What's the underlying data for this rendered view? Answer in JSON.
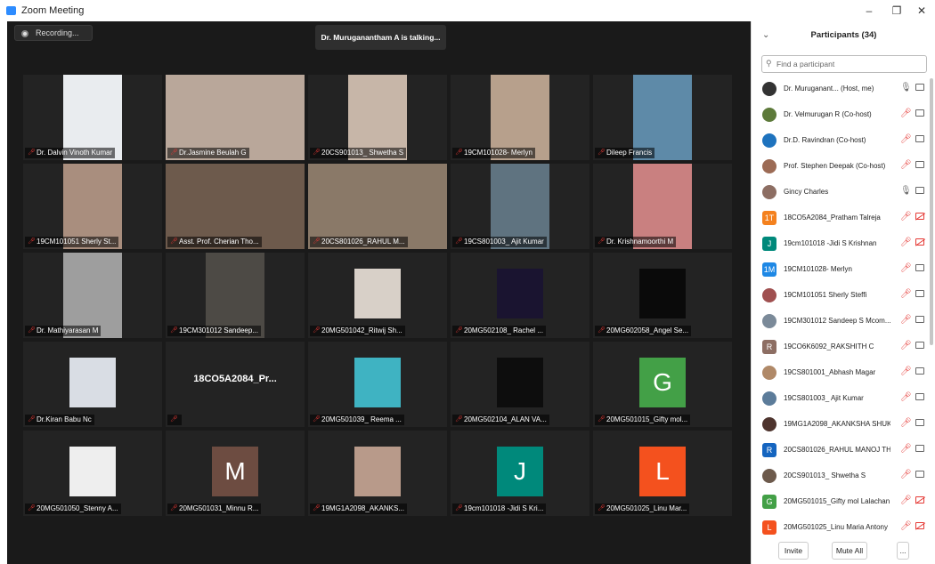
{
  "window": {
    "title": "Zoom Meeting"
  },
  "meeting": {
    "recording_label": "Recording...",
    "talking_label": "Dr. Muruganantham A is talking..."
  },
  "tiles": [
    {
      "name": "Dr. Dalvin Vinoth Kumar",
      "color": "#e9ecef"
    },
    {
      "name": "Dr.Jasmine Beulah G",
      "color": "#b9a79a"
    },
    {
      "name": "20CS901013_ Shwetha S",
      "color": "#c7b6a8"
    },
    {
      "name": "19CM101028- Merlyn",
      "color": "#b7a08c"
    },
    {
      "name": "Dileep Francis",
      "color": "#5e8aa8"
    },
    {
      "name": "19CM101051 Sherly St...",
      "color": "#a98e7e"
    },
    {
      "name": "Asst. Prof. Cherian Tho...",
      "color": "#6d5a4c"
    },
    {
      "name": "20CS801026_RAHUL M...",
      "color": "#8a7968"
    },
    {
      "name": "19CS801003_ Ajit Kumar",
      "color": "#5f7380"
    },
    {
      "name": "Dr. Krishnamoorthi M",
      "color": "#c98080"
    },
    {
      "name": "Dr. Mathiyarasan M",
      "color": "#9e9e9e"
    },
    {
      "name": "19CM301012 Sandeep...",
      "color": "#4d4a45"
    },
    {
      "name": "20MG501042_Ritwij Sh...",
      "color": "#d8d0c8"
    },
    {
      "name": "20MG502108_ Rachel ...",
      "color": "#1a1430"
    },
    {
      "name": "20MG602058_Angel Se...",
      "color": "#0a0a0a"
    },
    {
      "name": "Dr.Kiran Babu Nc",
      "color": "#d9dde4"
    },
    {
      "name": "",
      "color": "#232323",
      "text": "18CO5A2084_Pr..."
    },
    {
      "name": "20MG501039_ Reema ...",
      "color": "#3fb3c2"
    },
    {
      "name": "20MG502104_ALAN VA...",
      "color": "#0d0d0d"
    },
    {
      "name": "20MG501015_Gifty mol...",
      "color": "#43a047",
      "letter": "G"
    },
    {
      "name": "20MG501050_Stenny A...",
      "color": "#eeeeee"
    },
    {
      "name": "20MG501031_Minnu R...",
      "color": "#6d4c41",
      "letter": "M"
    },
    {
      "name": "19MG1A2098_AKANKS...",
      "color": "#b89a8a"
    },
    {
      "name": "19cm101018 -Jidi S Kri...",
      "color": "#00897b",
      "letter": "J"
    },
    {
      "name": "20MG501025_Linu Mar...",
      "color": "#f4511e",
      "letter": "L"
    }
  ],
  "participants": {
    "title": "Participants (34)",
    "search_placeholder": "Find a participant",
    "items": [
      {
        "name": "Dr. Muruganant...  (Host, me)",
        "av": "",
        "color": "#333333",
        "mic": "on"
      },
      {
        "name": "Dr. Velmurugan R (Co-host)",
        "av": "",
        "color": "#5d7a3a",
        "mic": "off"
      },
      {
        "name": "Dr.D. Ravindran (Co-host)",
        "av": "",
        "color": "#1e73be",
        "mic": "off"
      },
      {
        "name": "Prof. Stephen Deepak (Co-host)",
        "av": "",
        "color": "#9c6b55",
        "mic": "off"
      },
      {
        "name": "Gincy Charles",
        "av": "",
        "color": "#8d6e63",
        "mic": "on"
      },
      {
        "name": "18CO5A2084_Pratham Talreja",
        "av": "1T",
        "color": "#f4811e",
        "mic": "off",
        "cam": "off"
      },
      {
        "name": "19cm101018 -Jidi S Krishnan",
        "av": "J",
        "color": "#00897b",
        "mic": "off",
        "cam": "off"
      },
      {
        "name": "19CM101028- Merlyn",
        "av": "1M",
        "color": "#1e88e5",
        "mic": "off"
      },
      {
        "name": "19CM101051 Sherly Steffi",
        "av": "",
        "color": "#a05050",
        "mic": "off"
      },
      {
        "name": "19CM301012 Sandeep S Mcom...",
        "av": "",
        "color": "#7b8a99",
        "mic": "off"
      },
      {
        "name": "19CO6K6092_RAKSHITH C",
        "av": "R",
        "color": "#8d6e63",
        "mic": "off"
      },
      {
        "name": "19CS801001_Abhash Magar",
        "av": "",
        "color": "#b08968",
        "mic": "off"
      },
      {
        "name": "19CS801003_ Ajit Kumar",
        "av": "",
        "color": "#5c7c9a",
        "mic": "off"
      },
      {
        "name": "19MG1A2098_AKANKSHA SHUK...",
        "av": "",
        "color": "#4e342e",
        "mic": "off"
      },
      {
        "name": "20CS801026_RAHUL MANOJ TH...",
        "av": "R",
        "color": "#1565c0",
        "mic": "off"
      },
      {
        "name": "20CS901013_ Shwetha S",
        "av": "",
        "color": "#6d5a4c",
        "mic": "off"
      },
      {
        "name": "20MG501015_Gifty mol Lalachan",
        "av": "G",
        "color": "#43a047",
        "mic": "off",
        "cam": "off"
      },
      {
        "name": "20MG501025_Linu Maria Antony",
        "av": "L",
        "color": "#f4511e",
        "mic": "off",
        "cam": "off"
      }
    ],
    "invite_label": "Invite",
    "mute_all_label": "Mute All",
    "more_label": "..."
  }
}
